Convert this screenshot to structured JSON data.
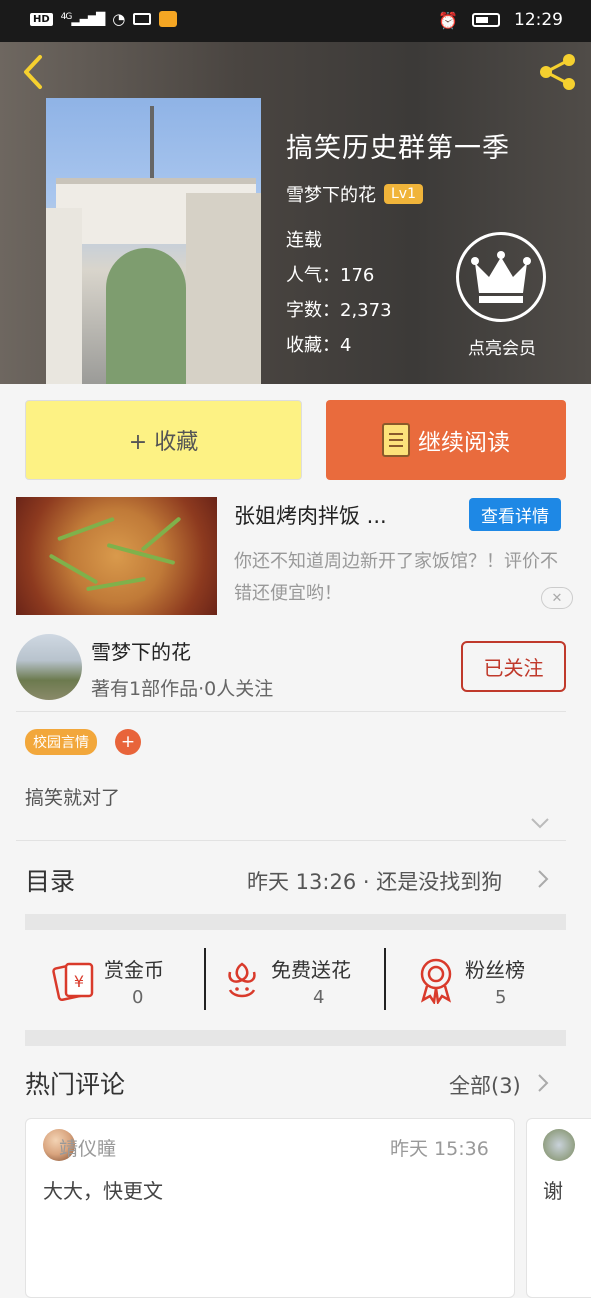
{
  "status_bar": {
    "hd": "HD",
    "network": "4G",
    "time": "12:29"
  },
  "book": {
    "title": "搞笑历史群第一季",
    "author": "雪梦下的花",
    "level": "Lv1",
    "status": "连载",
    "popularity": "人气：176",
    "word_count": "字数：2,373",
    "favorites": "收藏：4",
    "vip_label": "点亮会员"
  },
  "actions": {
    "collect_label": "+ 收藏",
    "read_label": "继续阅读"
  },
  "ad": {
    "title": "张姐烤肉拌饭 ...",
    "button": "查看详情",
    "desc": "你还不知道周边新开了家饭馆？！评价不错还便宜哟！"
  },
  "author_card": {
    "name": "雪梦下的花",
    "sub": "著有1部作品·0人关注",
    "follow_label": "已关注"
  },
  "tags": {
    "tag1": "校园言情",
    "add": "+"
  },
  "description": "搞笑就对了",
  "toc": {
    "title": "目录",
    "latest": "昨天 13:26 · 还是没找到狗"
  },
  "stats": [
    {
      "label": "赏金币",
      "value": "0",
      "icon": "reward-coin-icon"
    },
    {
      "label": "免费送花",
      "value": "4",
      "icon": "flower-icon"
    },
    {
      "label": "粉丝榜",
      "value": "5",
      "icon": "medal-icon"
    }
  ],
  "comments": {
    "title": "热门评论",
    "all_label": "全部(3)",
    "items": [
      {
        "user": "靖仪瞳",
        "time": "昨天 15:36",
        "text": "大大，快更文"
      },
      {
        "user": "",
        "time": "",
        "text": "谢"
      }
    ]
  },
  "colors": {
    "accent_orange": "#e96b3d",
    "collect_yellow": "#fdf284",
    "ad_blue": "#1e88e5",
    "follow_red": "#c0392b",
    "level_gold": "#f0b43a"
  }
}
